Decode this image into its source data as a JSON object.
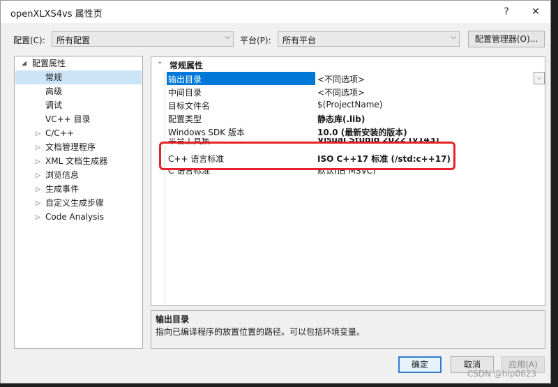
{
  "window": {
    "title": "openXLXS4vs 属性页",
    "help_glyph": "?",
    "close_glyph": "✕"
  },
  "toolbar": {
    "config_label": "配置(C):",
    "config_value": "所有配置",
    "platform_label": "平台(P):",
    "platform_value": "所有平台",
    "config_manager_label": "配置管理器(O)..."
  },
  "tree": {
    "root_label": "配置属性",
    "items": [
      {
        "label": "常规",
        "selected": true
      },
      {
        "label": "高级"
      },
      {
        "label": "调试"
      },
      {
        "label": "VC++ 目录"
      },
      {
        "label": "C/C++",
        "expandable": true
      },
      {
        "label": "文档管理程序",
        "expandable": true
      },
      {
        "label": "XML 文档生成器",
        "expandable": true
      },
      {
        "label": "浏览信息",
        "expandable": true
      },
      {
        "label": "生成事件",
        "expandable": true
      },
      {
        "label": "自定义生成步骤",
        "expandable": true
      },
      {
        "label": "Code Analysis",
        "expandable": true
      }
    ]
  },
  "grid": {
    "section_title": "常规属性",
    "rows": [
      {
        "name": "输出目录",
        "value": "<不同选项>",
        "selected": true
      },
      {
        "name": "中间目录",
        "value": "<不同选项>"
      },
      {
        "name": "目标文件名",
        "value": "$(ProjectName)"
      },
      {
        "name": "配置类型",
        "value": "静态库(.lib)",
        "bold": true
      },
      {
        "name": "Windows SDK 版本",
        "value": "10.0 (最新安装的版本)",
        "bold": true
      },
      {
        "name": "平台工具集",
        "value": "Visual Studio 2022 (v143)",
        "bold": true
      },
      {
        "name": "C++ 语言标准",
        "value": "ISO C++17 标准 (/std:c++17)",
        "bold": true
      },
      {
        "name": "C 语言标准",
        "value": "默认(旧 MSVC)"
      }
    ]
  },
  "description": {
    "title": "输出目录",
    "text": "指向已编译程序的放置位置的路径。可以包括环境变量。"
  },
  "buttons": {
    "ok": "确定",
    "cancel": "取消",
    "apply": "应用(A)"
  },
  "watermark": "CSDN @hlp0623",
  "colors": {
    "selection": "#0078d7",
    "tree_selection": "#cce4f7",
    "highlight_box": "#e8202a"
  }
}
